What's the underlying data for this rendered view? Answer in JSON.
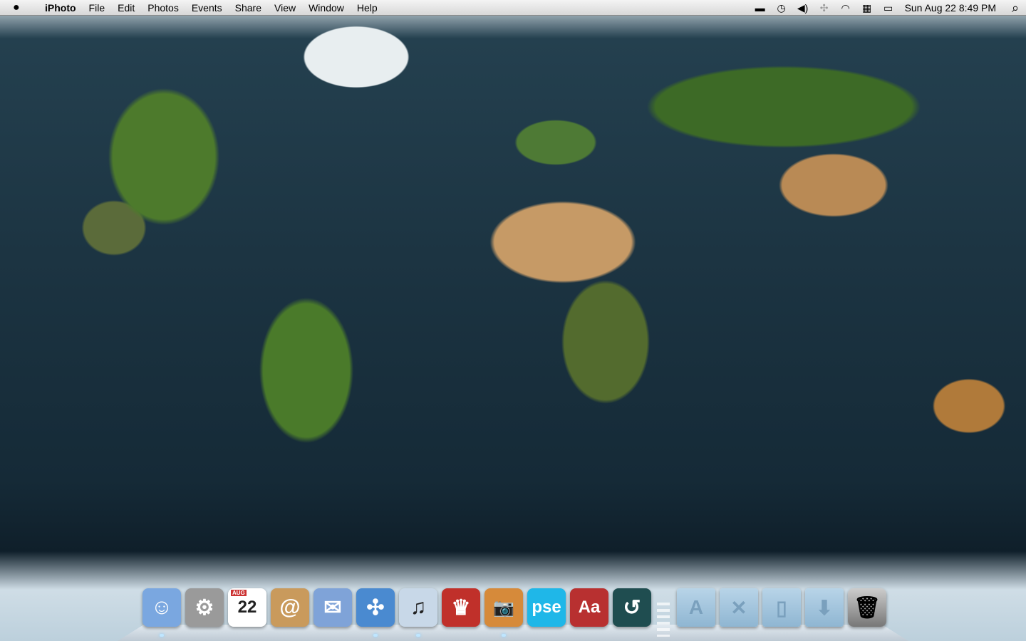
{
  "menubar": {
    "apple": "",
    "app": "iPhoto",
    "items": [
      "File",
      "Edit",
      "Photos",
      "Events",
      "Share",
      "View",
      "Window",
      "Help"
    ],
    "status_icons": [
      "display-icon",
      "time-machine-icon",
      "volume-icon",
      "bluetooth-icon",
      "wifi-icon",
      "input-menu-icon",
      "battery-icon"
    ],
    "clock": "Sun Aug 22  8:49 PM",
    "spotlight": "⌕"
  },
  "dock": {
    "apps": [
      {
        "name": "Finder",
        "glyph": "☺",
        "color": "#7aa7e0",
        "running": true
      },
      {
        "name": "System Preferences",
        "glyph": "⚙",
        "color": "#9a9a9a",
        "running": false
      },
      {
        "name": "iCal",
        "glyph": "22",
        "month": "AUG",
        "color": "#ffffff",
        "running": false
      },
      {
        "name": "Address Book",
        "glyph": "@",
        "color": "#c99a5c",
        "running": false
      },
      {
        "name": "Mail",
        "glyph": "✉",
        "color": "#7fa3d8",
        "running": false
      },
      {
        "name": "Safari",
        "glyph": "✣",
        "color": "#4a8ad0",
        "running": true
      },
      {
        "name": "iTunes",
        "glyph": "♫",
        "color": "#c8d8e8",
        "running": true
      },
      {
        "name": "Front Row",
        "glyph": "♛",
        "color": "#c0302a",
        "running": false
      },
      {
        "name": "iPhoto",
        "glyph": "📷",
        "color": "#d68a3a",
        "running": true
      },
      {
        "name": "Photoshop Elements",
        "glyph": "pse",
        "color": "#1fb7e8",
        "running": false
      },
      {
        "name": "Dictionary",
        "glyph": "Aa",
        "color": "#b83030",
        "running": false
      },
      {
        "name": "Time Machine",
        "glyph": "↺",
        "color": "#1f4d50",
        "running": false
      }
    ],
    "folders": [
      {
        "name": "Applications",
        "glyph": "A"
      },
      {
        "name": "Utilities",
        "glyph": "✕"
      },
      {
        "name": "Documents",
        "glyph": "▯"
      },
      {
        "name": "Downloads",
        "glyph": "⬇"
      }
    ],
    "trash": {
      "name": "Trash",
      "glyph": "🗑"
    }
  }
}
